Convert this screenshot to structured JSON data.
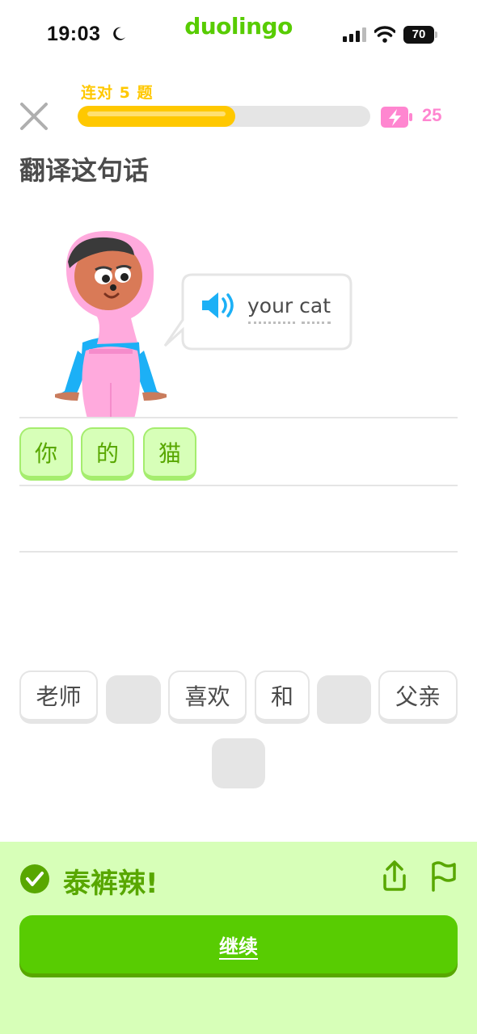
{
  "status_bar": {
    "time": "19:03",
    "brand": "duolingo",
    "battery": "70"
  },
  "header": {
    "streak_label": "连对 5 题",
    "progress": 0.54,
    "energy": "25"
  },
  "prompt": {
    "title": "翻译这句话",
    "words": [
      "your",
      "cat"
    ],
    "phrase": "your cat"
  },
  "answer": [
    "你",
    "的",
    "猫"
  ],
  "word_bank": {
    "row1": [
      "老师",
      "",
      "喜欢",
      "和",
      "",
      "父亲"
    ],
    "row2": [
      ""
    ]
  },
  "feedback": {
    "title": "泰裤辣!",
    "continue_label": "继续"
  },
  "colors": {
    "brand_green": "#58cc02",
    "streak_yellow": "#ffc800",
    "energy_pink": "#ff86d0",
    "success_bg": "#d7ffb8",
    "success_text": "#58a700",
    "speaker_blue": "#1cb0f6"
  },
  "icons": {
    "close": "close-icon",
    "energy": "lightning-battery-icon",
    "speaker": "speaker-icon",
    "check": "check-circle-icon",
    "share": "share-icon",
    "report": "flag-icon"
  }
}
